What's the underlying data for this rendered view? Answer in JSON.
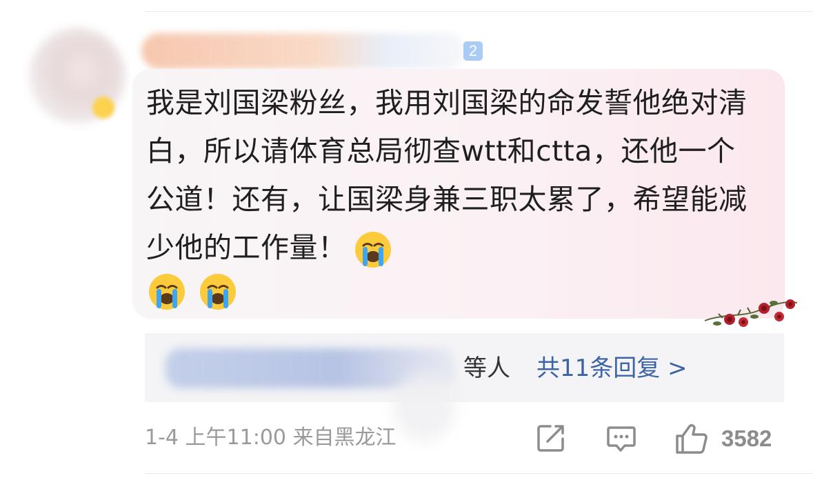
{
  "comment": {
    "level_badge": "2",
    "text": "我是刘国梁粉丝，我用刘国梁的命发誓他绝对清白，所以请体育总局彻查wtt和ctta，还他一个公道！还有，让国梁身兼三职太累了，希望能减少他的工作量！",
    "emoji_count": 3,
    "emoji": "loudly-crying-face"
  },
  "replies": {
    "others_label": "等人",
    "total_label": "共11条回复 >"
  },
  "footer": {
    "date": "1-4",
    "time": "上午11:00",
    "location": "来自黑龙江",
    "like_count": "3582"
  },
  "colors": {
    "link": "#3d63a5",
    "meta_text": "#9a9a9a",
    "bubble_tint": "#fbe8ee"
  }
}
